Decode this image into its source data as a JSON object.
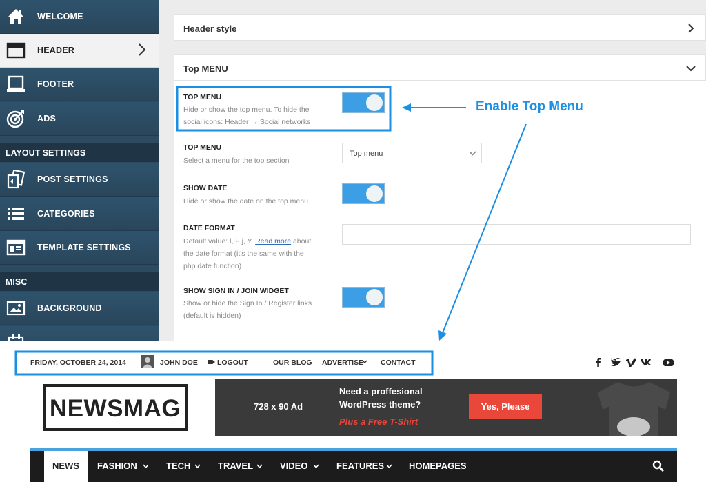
{
  "sidebar": {
    "items": [
      {
        "label": "WELCOME",
        "icon": "home-icon"
      },
      {
        "label": "HEADER",
        "icon": "header-icon"
      },
      {
        "label": "FOOTER",
        "icon": "footer-icon"
      },
      {
        "label": "ADS",
        "icon": "target-icon"
      },
      {
        "label": "POST SETTINGS",
        "icon": "post-settings-icon"
      },
      {
        "label": "CATEGORIES",
        "icon": "list-icon"
      },
      {
        "label": "TEMPLATE SETTINGS",
        "icon": "template-icon"
      },
      {
        "label": "BACKGROUND",
        "icon": "image-icon"
      }
    ],
    "sections": [
      "LAYOUT SETTINGS",
      "MISC"
    ]
  },
  "settings": {
    "accordions": [
      {
        "title": "Header style",
        "state": "collapsed"
      },
      {
        "title": "Top MENU",
        "state": "expanded"
      }
    ],
    "options": [
      {
        "title": "TOP MENU",
        "desc1": "Hide or show the top menu. To hide the",
        "desc2": "social icons: Header → Social networks",
        "control": "toggle",
        "enabled": true
      },
      {
        "title": "TOP MENU",
        "desc1": "Select a menu for the top section",
        "control": "select",
        "value": "Top menu"
      },
      {
        "title": "SHOW DATE",
        "desc1": "Hide or show the date on the top menu",
        "control": "toggle",
        "enabled": true
      },
      {
        "title": "DATE FORMAT",
        "desc1_pre": "Default value: l, F j, Y. ",
        "desc1_link": "Read more",
        "desc1_post": " about",
        "desc2": "the date format (it's the same with the",
        "desc3": "php date function)",
        "control": "text",
        "value": ""
      },
      {
        "title": "SHOW SIGN IN / JOIN WIDGET",
        "desc1": "Show or hide the Sign In / Register links",
        "desc2": "(default is hidden)",
        "control": "toggle",
        "enabled": true
      }
    ]
  },
  "callout": {
    "text": "Enable Top Menu",
    "color": "#1a8fe3"
  },
  "topbar": {
    "date": "FRIDAY, OCTOBER 24, 2014",
    "user": "JOHN DOE",
    "logout": "LOGOUT",
    "menu": [
      "OUR BLOG",
      "ADVERTISE",
      "CONTACT"
    ],
    "social_icons": [
      "facebook-icon",
      "twitter-icon",
      "vimeo-icon",
      "vk-icon",
      "youtube-icon"
    ]
  },
  "logo": {
    "text": "NEWSMAG"
  },
  "ad": {
    "size": "728 x 90 Ad",
    "line1": "Need a proffesional",
    "line2": "WordPress theme?",
    "line3": "Plus a Free T-Shirt",
    "button": "Yes, Please"
  },
  "mainnav": {
    "items": [
      "NEWS",
      "FASHION",
      "TECH",
      "TRAVEL",
      "VIDEO",
      "FEATURES",
      "HOMEPAGES"
    ],
    "active": "NEWS",
    "accent": "#4aa3df"
  }
}
